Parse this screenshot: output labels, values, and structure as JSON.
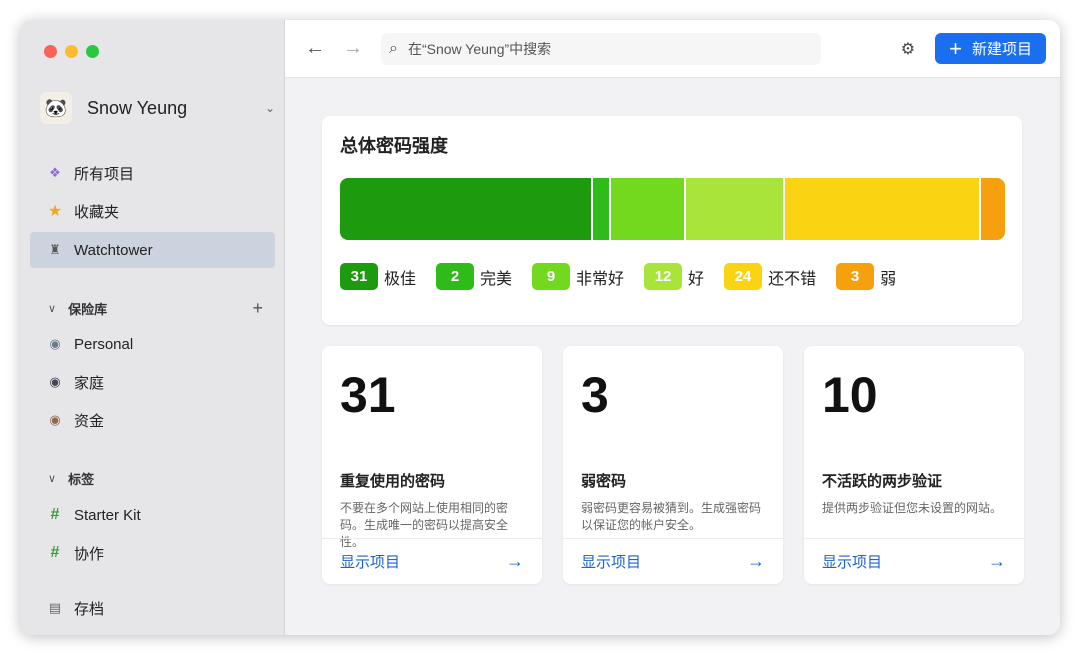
{
  "sidebar": {
    "account": "Snow Yeung",
    "items": [
      {
        "label": "所有项目",
        "icon": "grid-icon"
      },
      {
        "label": "收藏夹",
        "icon": "star-icon"
      },
      {
        "label": "Watchtower",
        "icon": "watchtower-icon"
      }
    ],
    "vaults_header": "保险库",
    "vaults": [
      "Personal",
      "家庭",
      "资金"
    ],
    "tags_header": "标签",
    "tags": [
      "Starter Kit",
      "协作"
    ],
    "archive": "存档"
  },
  "toolbar": {
    "search_placeholder": "在“Snow Yeung”中搜索",
    "new_item": "新建项目"
  },
  "strength": {
    "title": "总体密码强度",
    "levels": [
      {
        "count": 31,
        "label": "极佳",
        "color": "#1e9a0e"
      },
      {
        "count": 2,
        "label": "完美",
        "color": "#2fbc1b"
      },
      {
        "count": 9,
        "label": "非常好",
        "color": "#73d91f"
      },
      {
        "count": 12,
        "label": "好",
        "color": "#a9e43a"
      },
      {
        "count": 24,
        "label": "还不错",
        "color": "#fad312"
      },
      {
        "count": 3,
        "label": "弱",
        "color": "#f7a00f"
      }
    ]
  },
  "stats": [
    {
      "number": "31",
      "title": "重复使用的密码",
      "desc": "不要在多个网站上使用相同的密码。生成唯一的密码以提高安全性。",
      "link": "显示项目"
    },
    {
      "number": "3",
      "title": "弱密码",
      "desc": "弱密码更容易被猜到。生成强密码以保证您的帐户安全。",
      "link": "显示项目"
    },
    {
      "number": "10",
      "title": "不活跃的两步验证",
      "desc": "提供两步验证但您未设置的网站。",
      "link": "显示项目"
    }
  ]
}
